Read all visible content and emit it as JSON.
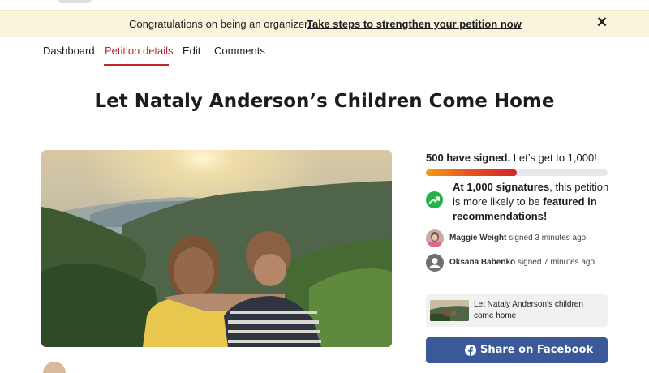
{
  "banner": {
    "message": "Congratulations on being an organizer.",
    "cta": "Take steps to strengthen your petition now",
    "close_icon": "close-icon"
  },
  "tabs": [
    {
      "label": "Dashboard",
      "active": false
    },
    {
      "label": "Petition details",
      "active": true
    },
    {
      "label": "Edit",
      "active": false
    },
    {
      "label": "Comments",
      "active": false
    }
  ],
  "petition": {
    "title": "Let Nataly Anderson’s Children Come Home"
  },
  "progress": {
    "signed_count": "500 have signed.",
    "goal_text": "Let’s get to 1,000!",
    "fraction": 0.5
  },
  "promo": {
    "part1": "At 1,000 signatures",
    "part2": ", this petition is more likely to be ",
    "part3": "featured in recommendations!",
    "icon": "trending-up-icon"
  },
  "signers": [
    {
      "name": "Maggie Weight",
      "action": "signed 3 minutes ago"
    },
    {
      "name": "Oksana Babenko",
      "action": "signed 7 minutes ago"
    }
  ],
  "share_card": {
    "text": "Let Nataly Anderson’s children come home"
  },
  "facebook": {
    "label": "Share on Facebook",
    "icon": "facebook-icon"
  },
  "colors": {
    "banner_bg": "#fbf4dc",
    "active_tab": "#c0272d",
    "facebook_blue": "#3b5998",
    "trend_green": "#25b24a"
  }
}
